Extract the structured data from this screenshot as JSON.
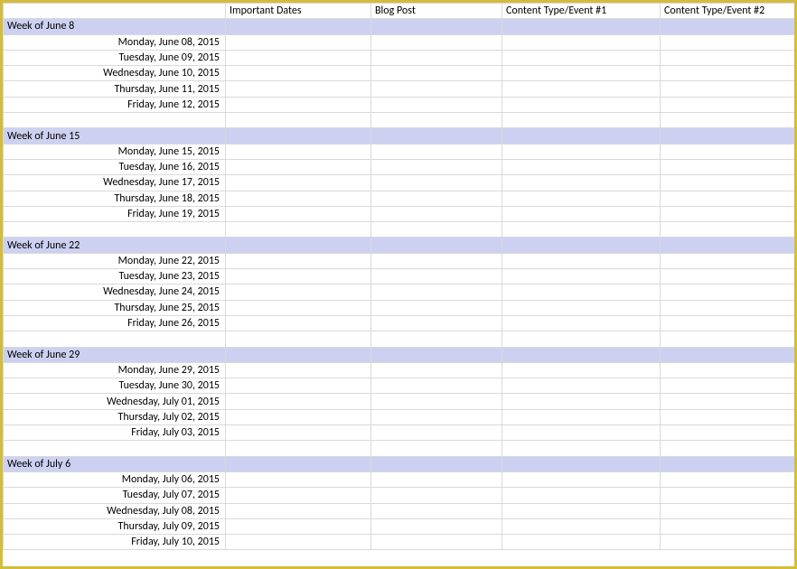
{
  "headers": {
    "date": "",
    "important_dates": "Important Dates",
    "blog_post": "Blog Post",
    "content_type_1": "Content Type/Event #1",
    "content_type_2": "Content Type/Event #2"
  },
  "weeks": [
    {
      "label": "Week of June 8",
      "days": [
        "Monday, June 08, 2015",
        "Tuesday, June 09, 2015",
        "Wednesday, June 10, 2015",
        "Thursday, June 11, 2015",
        "Friday, June 12, 2015"
      ]
    },
    {
      "label": "Week of June 15",
      "days": [
        "Monday, June 15, 2015",
        "Tuesday, June 16, 2015",
        "Wednesday, June 17, 2015",
        "Thursday, June 18, 2015",
        "Friday, June 19, 2015"
      ]
    },
    {
      "label": "Week of June 22",
      "days": [
        "Monday, June 22, 2015",
        "Tuesday, June 23, 2015",
        "Wednesday, June 24, 2015",
        "Thursday, June 25, 2015",
        "Friday, June 26, 2015"
      ]
    },
    {
      "label": "Week of June 29",
      "days": [
        "Monday, June 29, 2015",
        "Tuesday, June 30, 2015",
        "Wednesday, July 01, 2015",
        "Thursday, July 02, 2015",
        "Friday, July 03, 2015"
      ]
    },
    {
      "label": "Week of July 6",
      "days": [
        "Monday, July 06, 2015",
        "Tuesday, July 07, 2015",
        "Wednesday, July 08, 2015",
        "Thursday, July 09, 2015",
        "Friday, July 10, 2015"
      ]
    }
  ]
}
